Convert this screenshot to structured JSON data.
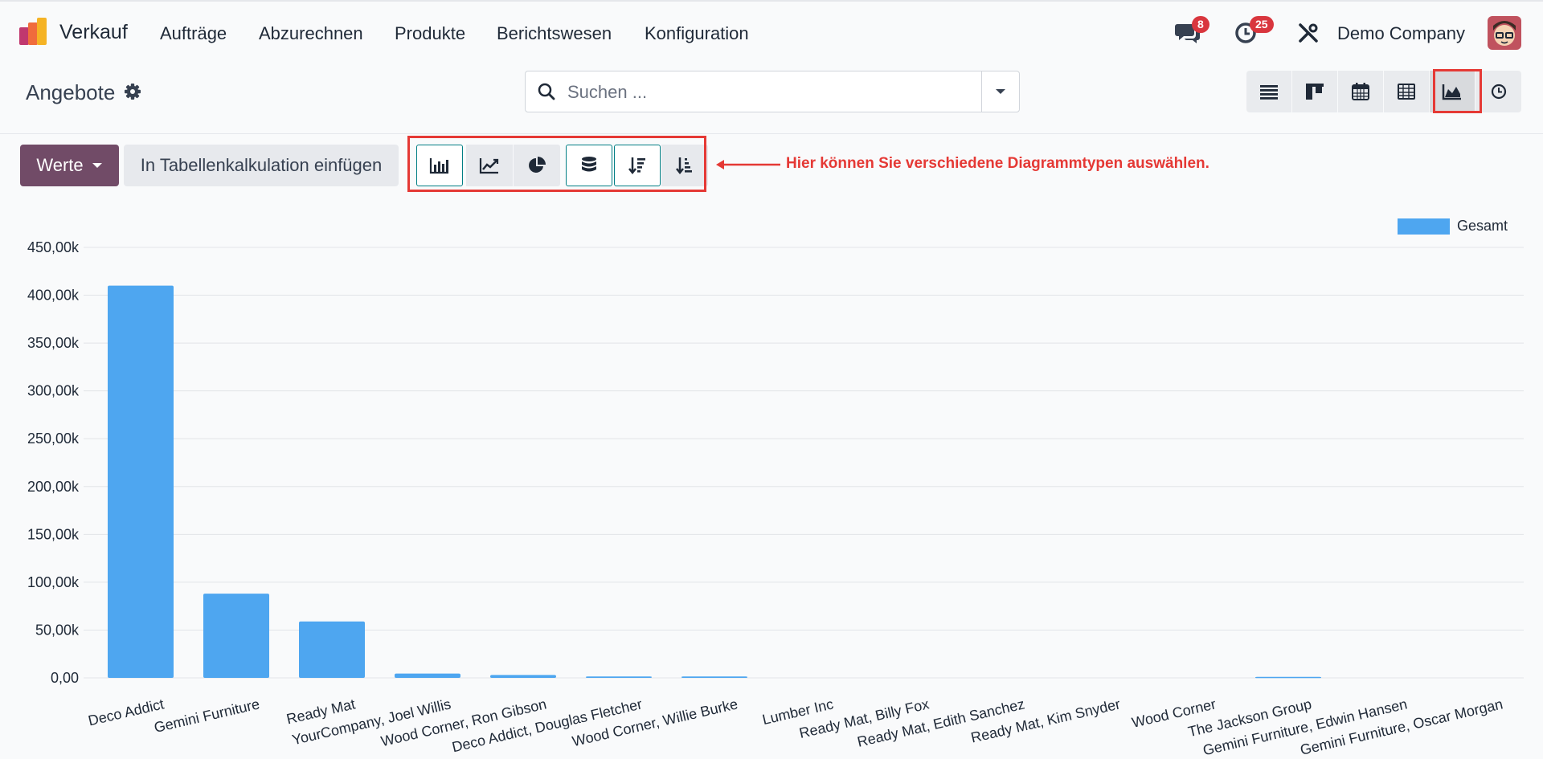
{
  "app": {
    "name": "Verkauf",
    "menu": [
      "Aufträge",
      "Abzurechnen",
      "Produkte",
      "Berichtswesen",
      "Konfiguration"
    ],
    "messages_badge": "8",
    "activities_badge": "25",
    "company": "Demo Company"
  },
  "control_panel": {
    "title": "Angebote",
    "search_placeholder": "Suchen ...",
    "views": [
      "list-icon",
      "kanban-icon",
      "calendar-icon",
      "pivot-icon",
      "graph-icon",
      "activity-icon"
    ],
    "active_view": "graph-icon"
  },
  "graph_toolbar": {
    "measures_label": "Werte",
    "insert_label": "In Tabellenkalkulation einfügen",
    "annotation": "Hier können Sie verschiedene Diagrammtypen auswählen."
  },
  "colors": {
    "brand": "#714b67",
    "bar": "#4ea6f0",
    "highlight": "#e53935",
    "active_border": "#017e84"
  },
  "chart_data": {
    "type": "bar",
    "categories": [
      "Deco Addict",
      "Gemini Furniture",
      "Ready Mat",
      "YourCompany, Joel Willis",
      "Wood Corner, Ron Gibson",
      "Deco Addict, Douglas Fletcher",
      "Wood Corner, Willie Burke",
      "Lumber Inc",
      "Ready Mat, Billy Fox",
      "Ready Mat, Edith Sanchez",
      "Ready Mat, Kim Snyder",
      "Wood Corner",
      "The Jackson Group",
      "Gemini Furniture, Edwin Hansen",
      "Gemini Furniture, Oscar Morgan"
    ],
    "series": [
      {
        "name": "Gesamt",
        "values": [
          410000,
          88000,
          59000,
          4500,
          3000,
          1500,
          1500,
          0,
          0,
          0,
          0,
          0,
          1000,
          0,
          0
        ]
      }
    ],
    "ylim": [
      0,
      450000
    ],
    "yticks": [
      "0,00",
      "50,00k",
      "100,00k",
      "150,00k",
      "200,00k",
      "250,00k",
      "300,00k",
      "350,00k",
      "400,00k",
      "450,00k"
    ],
    "grid": true,
    "legend_position": "top-right"
  }
}
